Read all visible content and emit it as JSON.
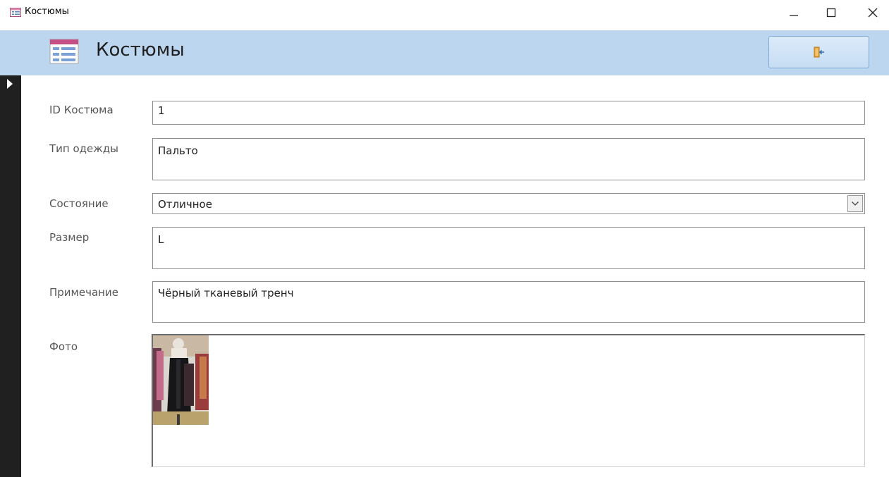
{
  "window": {
    "title": "Костюмы"
  },
  "header": {
    "title": "Костюмы",
    "exit_icon": "exit-door-icon"
  },
  "fields": {
    "id": {
      "label": "ID Костюма",
      "value": "1"
    },
    "type": {
      "label": "Тип одежды",
      "value": "Пальто"
    },
    "condition": {
      "label": "Состояние",
      "value": "Отличное"
    },
    "size": {
      "label": "Размер",
      "value": "L"
    },
    "note": {
      "label": "Примечание",
      "value": "Чёрный тканевый тренч"
    },
    "photo": {
      "label": "Фото"
    }
  },
  "colors": {
    "header_band": "#bcd6ef",
    "record_selector": "#202020",
    "form_icon": "#b04a78"
  }
}
